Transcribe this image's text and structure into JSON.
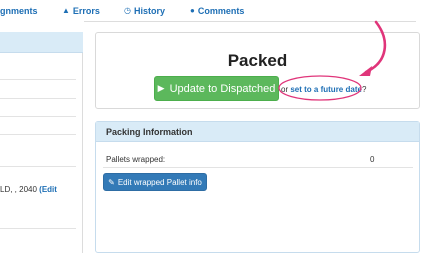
{
  "nav": {
    "assignments": "gnments",
    "errors": "Errors",
    "history": "History",
    "comments": "Comments"
  },
  "left_panel": {
    "address_text": "LD, , 2040",
    "edit_label": "(Edit"
  },
  "status": {
    "title": "Packed",
    "dispatch_button": "Update to Dispatched",
    "or_text": "or",
    "future_link": "set to a future date",
    "question_mark": "?"
  },
  "packing": {
    "header": "Packing Information",
    "pallets_label": "Pallets wrapped:",
    "pallets_value": "0",
    "edit_button": "Edit wrapped Pallet info"
  },
  "colors": {
    "link": "#1e6fb5",
    "success": "#5cb85c",
    "primary": "#337ab7",
    "panel_header": "#d9ebf7",
    "annotation": "#e0357a"
  },
  "icons": {
    "errors": "warning-icon",
    "history": "clock-icon",
    "comments": "speech-bubble-icon",
    "dispatch": "play-icon",
    "edit": "pencil-icon"
  }
}
